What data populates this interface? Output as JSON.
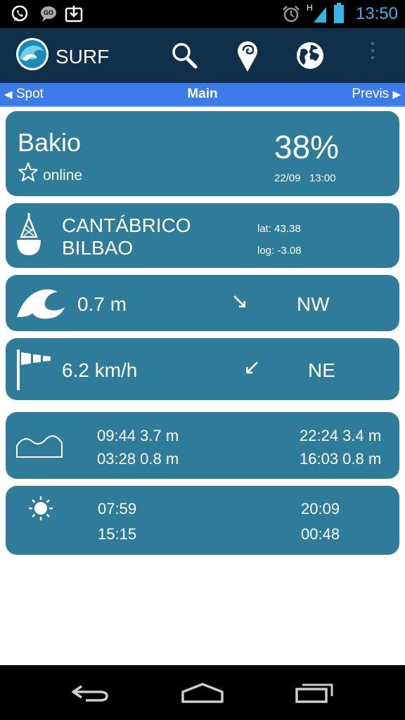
{
  "status_bar": {
    "time": "13:50",
    "network_label": "H"
  },
  "app": {
    "title": "SURF"
  },
  "nav": {
    "left": "Spot",
    "center": "Main",
    "right": "Previs"
  },
  "spot": {
    "name": "Bakio",
    "status": "online",
    "percentage": "38%",
    "date": "22/09",
    "time": "13:00"
  },
  "buoy": {
    "line1": "CANTÁBRICO",
    "line2": "BILBAO",
    "lat": "lat: 43.38",
    "log": "log: -3.08"
  },
  "wave": {
    "height": "0.7 m",
    "direction": "NW",
    "arrow": "↘"
  },
  "wind": {
    "speed": "6.2 km/h",
    "direction": "NE",
    "arrow": "↙"
  },
  "tides": {
    "row1_left": "09:44 3.7 m",
    "row2_left": "03:28 0.8 m",
    "row1_right": "22:24 3.4 m",
    "row2_right": "16:03 0.8 m"
  },
  "sun_moon": {
    "sunrise": "07:59",
    "sunset": "20:09",
    "moonrise": "15:15",
    "moonset": "00:48"
  },
  "colors": {
    "card": "#2e7c9a",
    "action_bar": "#0f2f4b",
    "nav_bar": "#3d7be8",
    "status_accent": "#33b5e5"
  }
}
